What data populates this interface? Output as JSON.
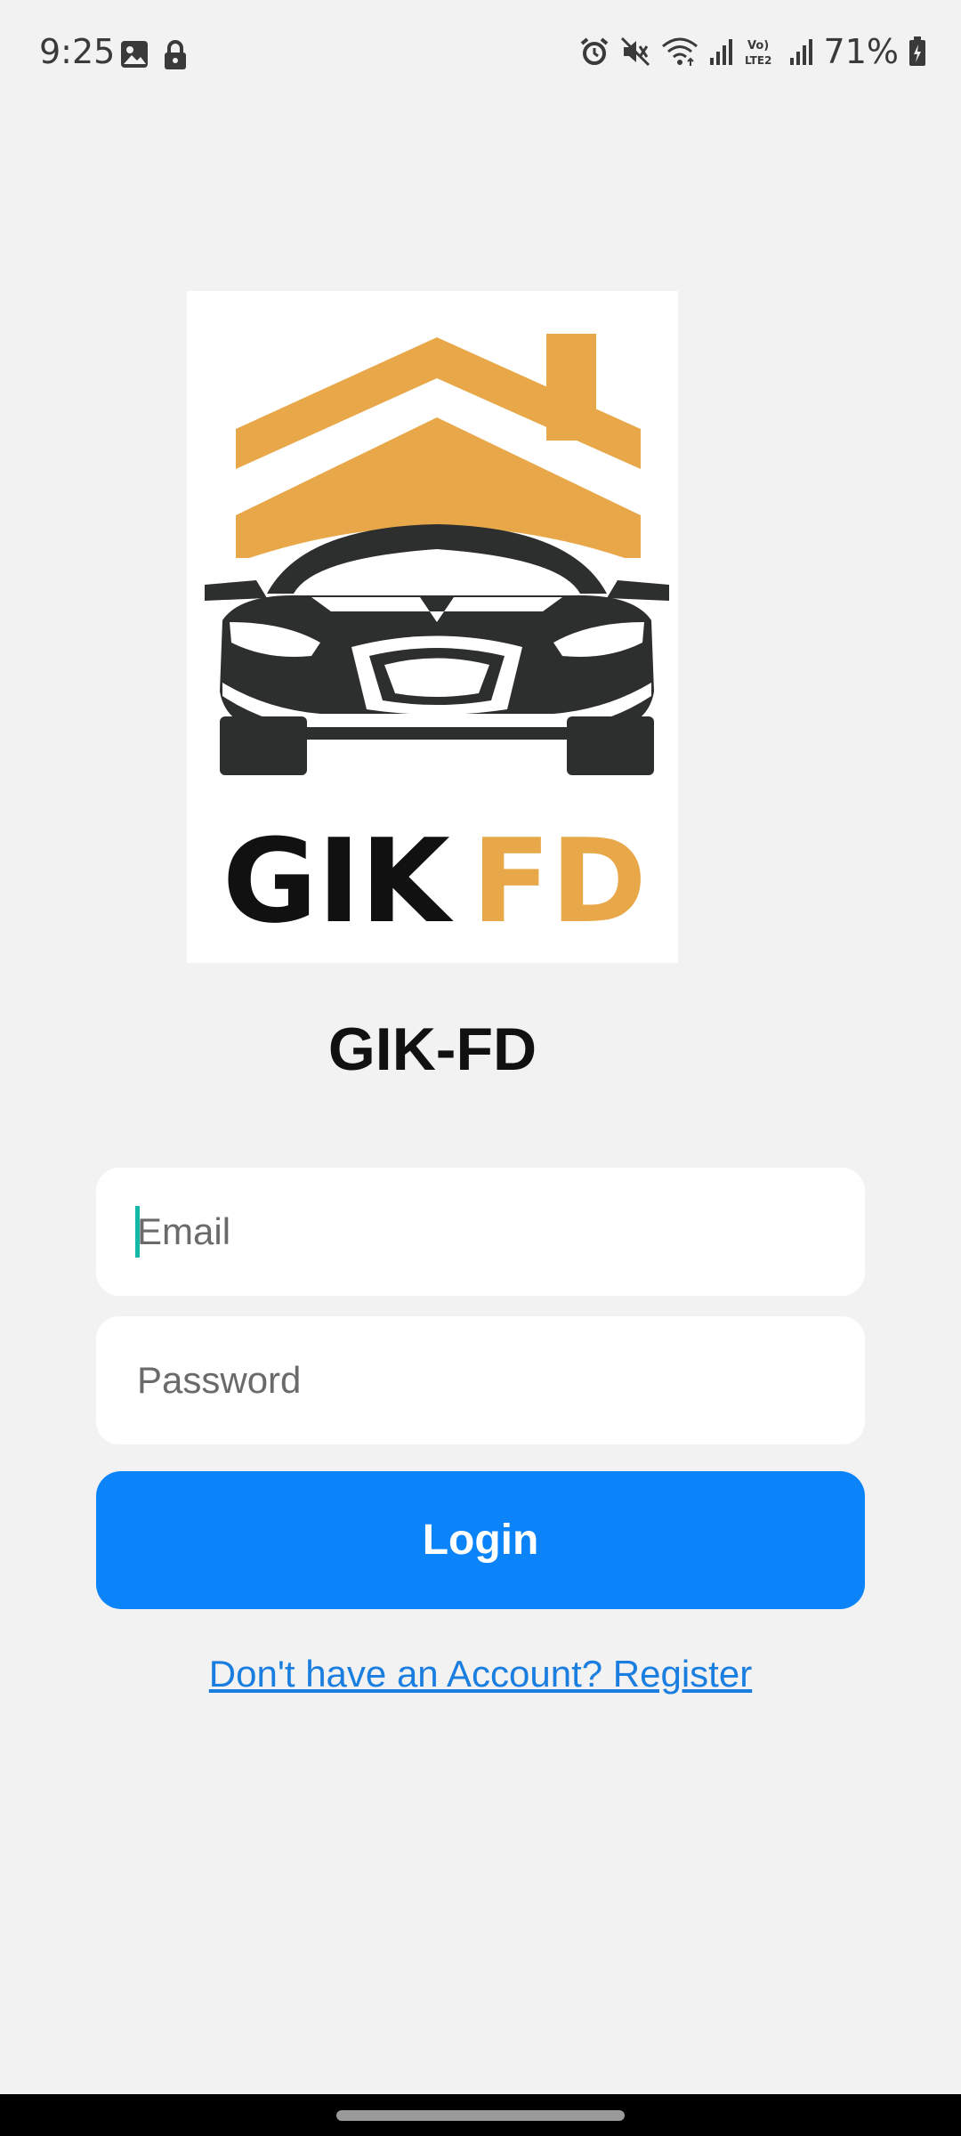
{
  "status_bar": {
    "time": "9:25",
    "left_icons": [
      "image-icon",
      "lock-icon"
    ],
    "right_icons": [
      "alarm-icon",
      "mute-icon",
      "wifi-icon",
      "signal-icon",
      "volte-icon",
      "signal-icon",
      "battery-icon"
    ],
    "volte_label": "Vo) LTE2",
    "battery_percent": "71%"
  },
  "logo": {
    "text_dark": "GIK",
    "text_accent": "FD",
    "colors": {
      "accent": "#e8a84a",
      "dark": "#2d2f2e"
    }
  },
  "app_title": "GIK-FD",
  "form": {
    "email_placeholder": "Email",
    "password_placeholder": "Password",
    "login_label": "Login",
    "register_link": "Don't have an Account? Register"
  },
  "colors": {
    "background": "#f2f2f2",
    "primary": "#0a84f8",
    "link": "#1a7ee0",
    "caret": "#14b8a6"
  }
}
